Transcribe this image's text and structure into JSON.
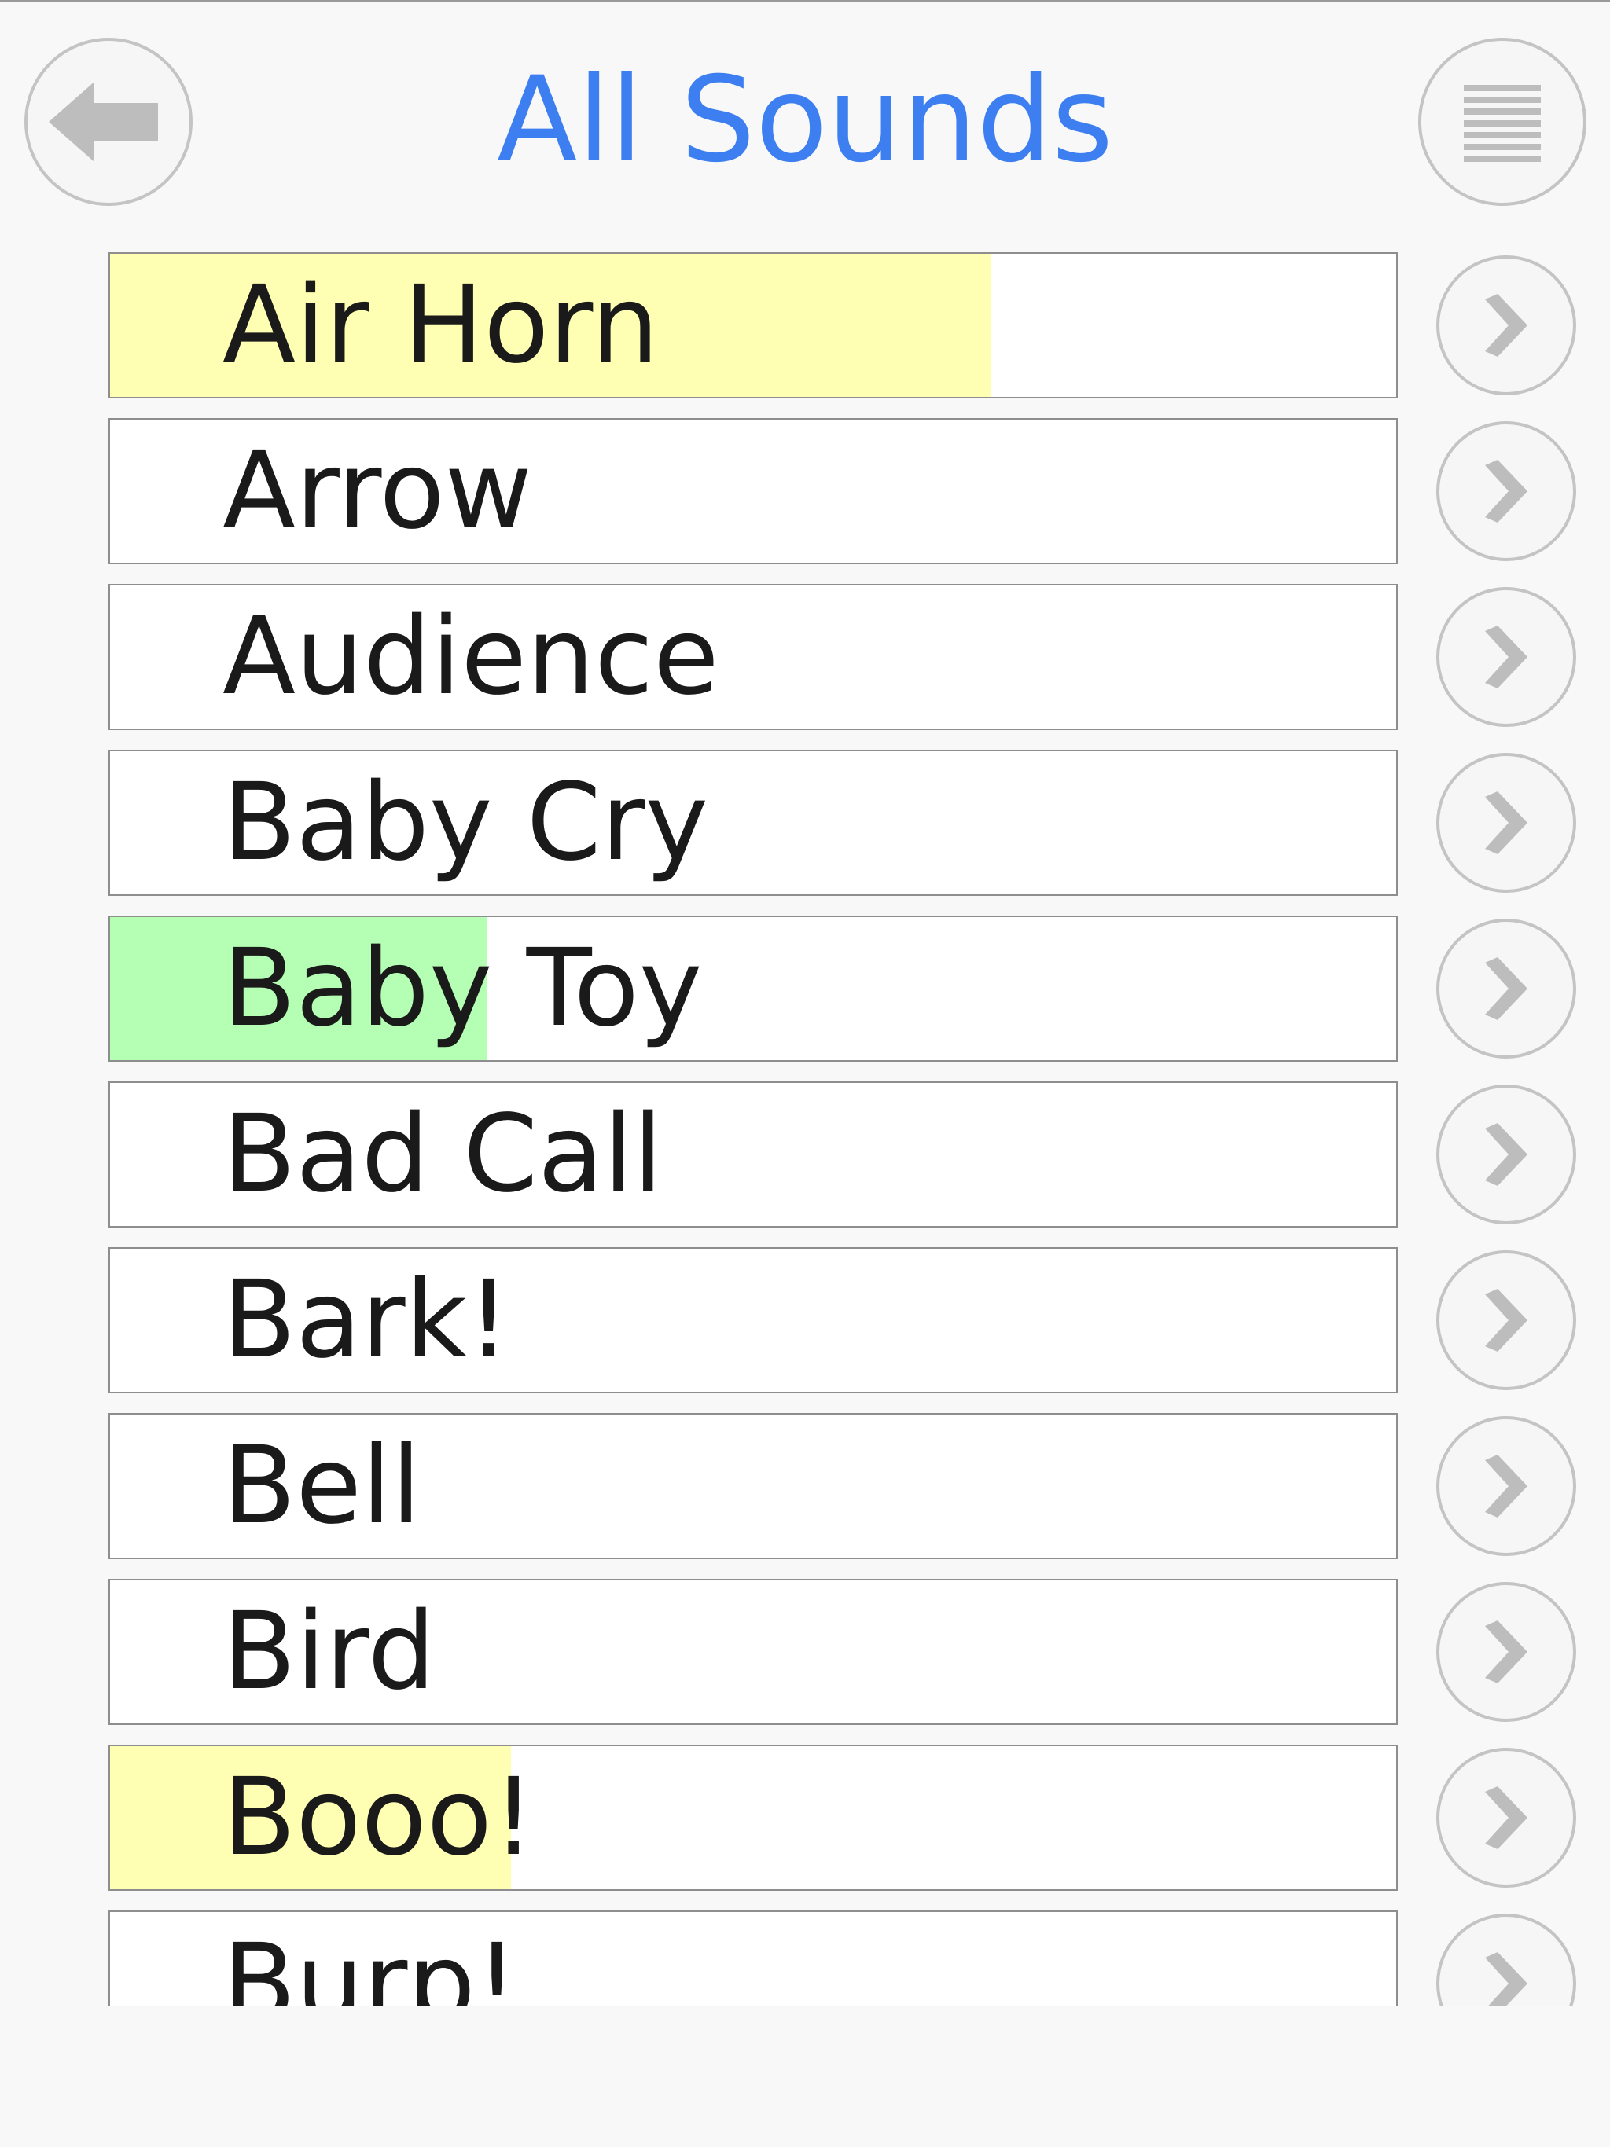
{
  "header": {
    "title": "All Sounds",
    "back_icon": "arrow-left-icon",
    "menu_icon": "list-menu-icon"
  },
  "colors": {
    "title": "#3d7ff0",
    "highlight_yellow": "#ffffb4",
    "highlight_green": "#b4ffb4",
    "button_border": "#c4c4c4",
    "icon_gray": "#bdbdbd"
  },
  "sounds": [
    {
      "label": "Air Horn",
      "highlight": "yellow",
      "progress": 0.685
    },
    {
      "label": "Arrow",
      "highlight": null,
      "progress": 0
    },
    {
      "label": "Audience",
      "highlight": null,
      "progress": 0
    },
    {
      "label": "Baby Cry",
      "highlight": null,
      "progress": 0
    },
    {
      "label": "Baby Toy",
      "highlight": "green",
      "progress": 0.293
    },
    {
      "label": "Bad Call",
      "highlight": null,
      "progress": 0
    },
    {
      "label": "Bark!",
      "highlight": null,
      "progress": 0
    },
    {
      "label": "Bell",
      "highlight": null,
      "progress": 0
    },
    {
      "label": "Bird",
      "highlight": null,
      "progress": 0
    },
    {
      "label": "Booo!",
      "highlight": "yellow",
      "progress": 0.312
    },
    {
      "label": "Burp!",
      "highlight": null,
      "progress": 0
    }
  ],
  "row_action_icon": "chevron-right-icon"
}
